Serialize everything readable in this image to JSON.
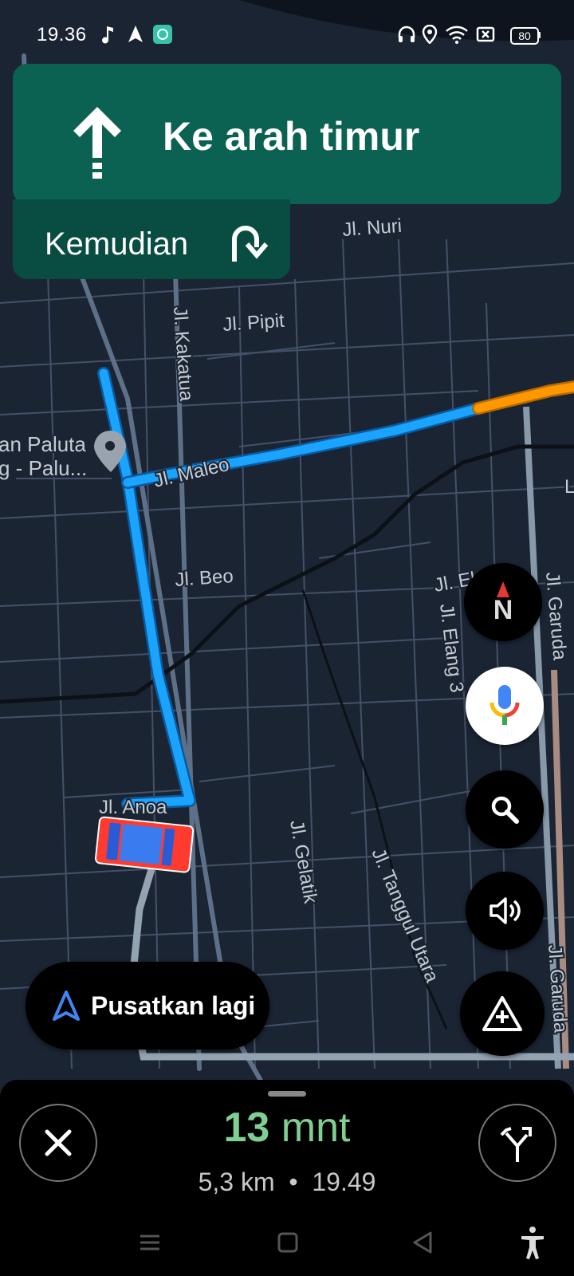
{
  "status_bar": {
    "time": "19.36",
    "battery": "80",
    "icons": [
      "music-note-icon",
      "navigation-icon",
      "app-notification-icon",
      "headphones-icon",
      "location-icon",
      "wifi-icon",
      "no-sim-icon"
    ]
  },
  "navigation": {
    "direction": "Ke arah timur",
    "then_label": "Kemudian",
    "direction_icon": "straight-arrow-icon",
    "then_icon": "u-turn-right-icon"
  },
  "map": {
    "place_label_line1": "an Paluta",
    "place_label_line2": "g - Palu...",
    "streets": [
      "Jl. Nuri",
      "Jl. Pipit",
      "Jl. Kakatua",
      "Jl. Maleo",
      "Jl. Beo",
      "Jl. El",
      "Jl. Elang 3",
      "Jl. Garuda",
      "Jl. Anoa",
      "Jl. Gelatik",
      "Jl. Tanggul Utara",
      "Jl. Garuda",
      "L"
    ]
  },
  "buttons": {
    "compass_label": "N",
    "recenter_label": "Pusatkan lagi"
  },
  "trip": {
    "eta_number": "13",
    "eta_unit": "mnt",
    "distance": "5,3 km",
    "separator": "•",
    "arrival_time": "19.49"
  },
  "colors": {
    "route": "#1aa3ff",
    "traffic": "#ff9800",
    "nav_card": "#0b6152",
    "eta": "#7fcf93"
  }
}
